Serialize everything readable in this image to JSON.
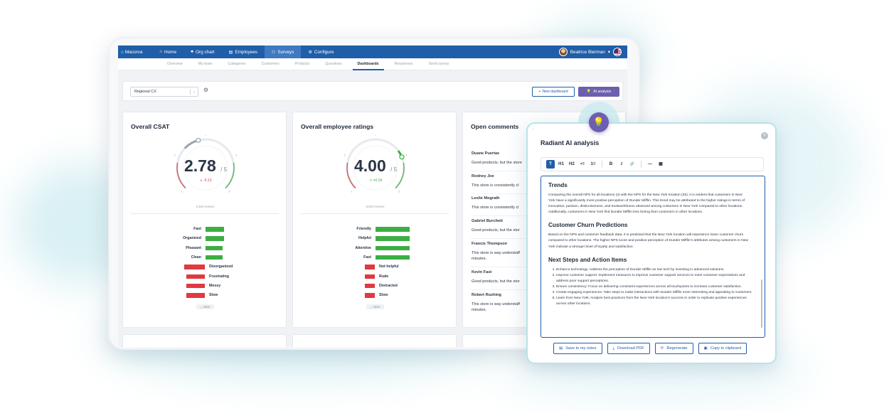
{
  "app": {
    "brand": "Macorva",
    "nav": [
      {
        "label": "Home",
        "icon": "home-icon",
        "glyph": "⌂"
      },
      {
        "label": "Org chart",
        "icon": "org-chart-icon",
        "glyph": "♣"
      },
      {
        "label": "Employees",
        "icon": "employees-icon",
        "glyph": "▤"
      },
      {
        "label": "Surveys",
        "icon": "surveys-icon",
        "glyph": "⚇"
      },
      {
        "label": "Configure",
        "icon": "configure-icon",
        "glyph": "⚙"
      }
    ],
    "user": {
      "name": "Beatrice Bierman",
      "caret": "▾"
    }
  },
  "subnav": [
    "Overview",
    "My team",
    "Categories",
    "Customers",
    "Products",
    "Questions",
    "Dashboards",
    "Responses",
    "Send survey"
  ],
  "toolbar": {
    "dashboard_select": "Regional CX",
    "new_dashboard": "New dashboard",
    "ai_analysis": "AI analysis"
  },
  "csat": {
    "title": "Overall CSAT",
    "value": "2.78",
    "out_of": "/ 5",
    "delta": "-0.13",
    "score": 2.78,
    "reviews": "3,450 reviews",
    "positive": [
      {
        "label": "Fast",
        "value": 0.55
      },
      {
        "label": "Organized",
        "value": 0.55
      },
      {
        "label": "Pleasant",
        "value": 0.5
      },
      {
        "label": "Clean",
        "value": 0.5
      }
    ],
    "negative": [
      {
        "label": "Disorganized",
        "value": 0.6
      },
      {
        "label": "Frustrating",
        "value": 0.55
      },
      {
        "label": "Messy",
        "value": 0.55
      },
      {
        "label": "Slow",
        "value": 0.55
      }
    ],
    "more": "⌄ More"
  },
  "employee": {
    "title": "Overall employee ratings",
    "value": "4.00",
    "out_of": "/ 5",
    "delta": "+0.19",
    "score": 4.0,
    "reviews": "8,530 reviews",
    "positive": [
      {
        "label": "Friendly",
        "value": 1.0
      },
      {
        "label": "Helpful",
        "value": 1.0
      },
      {
        "label": "Attentive",
        "value": 1.0
      },
      {
        "label": "Fast",
        "value": 1.0
      }
    ],
    "negative": [
      {
        "label": "Not helpful",
        "value": 0.3
      },
      {
        "label": "Rude",
        "value": 0.3
      },
      {
        "label": "Distracted",
        "value": 0.3
      },
      {
        "label": "Slow",
        "value": 0.3
      }
    ],
    "more": "⌄ More"
  },
  "gauge_ticks": [
    "1",
    "2",
    "3",
    "4",
    "5"
  ],
  "comments": {
    "title": "Open comments",
    "items": [
      {
        "name": "Duane Puertas",
        "text": "Good products, but the store"
      },
      {
        "name": "Rodney Joe",
        "text": "This store is consistently cl"
      },
      {
        "name": "Leslie Mograth",
        "text": "This store is consistently cl"
      },
      {
        "name": "Gabriel Burchett",
        "text": "Good products, but the stor"
      },
      {
        "name": "Francis Thompson",
        "text": "This store is way understaff",
        "text2": "minutes."
      },
      {
        "name": "Kevin Fast",
        "text": "Good products, but the stor"
      },
      {
        "name": "Robert Rushing",
        "text": "This store is way understaff",
        "text2": "minutes."
      }
    ]
  },
  "ai": {
    "title": "Radiant AI analysis",
    "toolbar": [
      "T",
      "H1",
      "H2",
      "•≡",
      "1≡",
      "B",
      "I",
      "🔗",
      "—",
      "▦"
    ],
    "sections": [
      {
        "heading": "Trends",
        "body": "Comparing the overall NPS for all locations (4) with the NPS for the New York location (25), it is evident that customers in New York have a significantly more positive perception of Dunder Mifflin. This trend may be attributed to the higher ratings in terms of innovation, passion, distinctiveness, and trustworthiness observed among customers in New York compared to other locations. Additionally, customers in New York find Dunder Mifflin less boring than customers in other locations."
      },
      {
        "heading": "Customer Churn Predictions",
        "body": "Based on the NPS and customer feedback data, it is predicted that the New York location will experience lower customer churn compared to other locations. The higher NPS score and positive perception of Dunder Mifflin's attributes among customers in New York indicate a stronger level of loyalty and satisfaction."
      }
    ],
    "next_steps": {
      "heading": "Next Steps and Action Items",
      "items": [
        "Enhance technology: Address the perception of Dunder Mifflin as low tech by investing in advanced solutions.",
        "Improve customer support: Implement measures to improve customer support services to meet customer expectations and address poor support perceptions.",
        "Ensure consistency: Focus on delivering consistent experiences across all touchpoints to increase customer satisfaction.",
        "Create engaging experiences: Take steps to make interactions with Dunder Mifflin more interesting and appealing to customers.",
        "Learn from New York: Analyze best practices from the New York location's success in order to replicate positive experiences across other locations."
      ]
    },
    "actions": [
      {
        "label": "Save to my notes",
        "icon": "notes-icon",
        "glyph": "▤"
      },
      {
        "label": "Download PDF",
        "icon": "download-icon",
        "glyph": "⤓"
      },
      {
        "label": "Regenerate",
        "icon": "regenerate-icon",
        "glyph": "⟳"
      },
      {
        "label": "Copy to clipboard",
        "icon": "clipboard-icon",
        "glyph": "▣"
      }
    ]
  },
  "colors": {
    "nav_blue": "#1f5ea8",
    "ai_purple": "#6c5fb0",
    "positive": "#3cae43",
    "negative": "#e0393f",
    "gauge_low": "#d0383e",
    "gauge_high": "#3cae43"
  }
}
